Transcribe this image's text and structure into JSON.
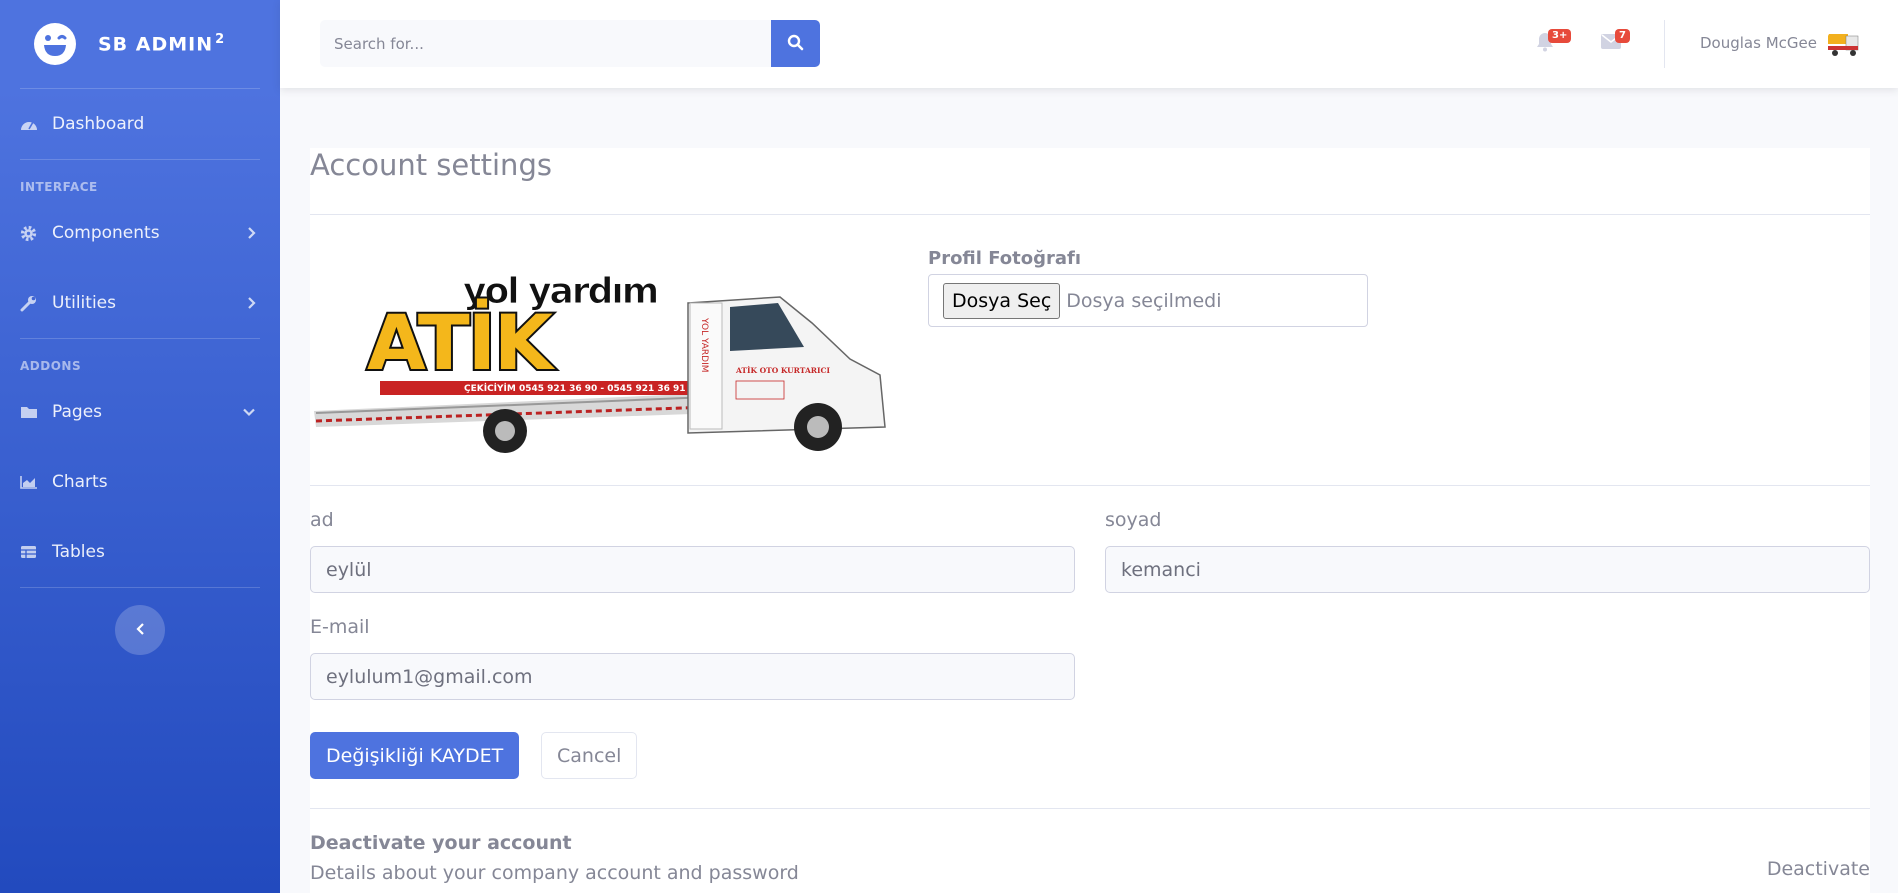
{
  "brand": {
    "name": "SB ADMIN",
    "version": "2"
  },
  "sidebar": {
    "dashboard": "Dashboard",
    "heading_interface": "INTERFACE",
    "components": "Components",
    "utilities": "Utilities",
    "heading_addons": "ADDONS",
    "pages": "Pages",
    "charts": "Charts",
    "tables": "Tables"
  },
  "topbar": {
    "search_placeholder": "Search for...",
    "alerts_count": "3+",
    "messages_count": "7",
    "user_name": "Douglas McGee"
  },
  "page": {
    "title": "Account settings",
    "photo_label": "Profil Fotoğrafı",
    "file_button": "Dosya Seç",
    "file_status": "Dosya seçilmedi",
    "logo": {
      "top_text": "yol yardım",
      "main_text": "ATİK",
      "side_text": "YOL YARDIM",
      "phone_text": "ÇEKİCİYİM 0545 921 36 90 - 0545 921 36 91",
      "door_text": "ATİK OTO KURTARICI"
    },
    "first_name_label": "ad",
    "first_name_value": "eylül",
    "last_name_label": "soyad",
    "last_name_value": "kemanci",
    "email_label": "E-mail",
    "email_value": "eylulum1@gmail.com",
    "save_label": "Değişikliği KAYDET",
    "cancel_label": "Cancel",
    "deactivate_title": "Deactivate your account",
    "deactivate_desc": "Details about your company account and password",
    "deactivate_link": "Deactivate"
  },
  "colors": {
    "primary": "#4e73df",
    "danger": "#e74a3b",
    "text": "#858796"
  }
}
